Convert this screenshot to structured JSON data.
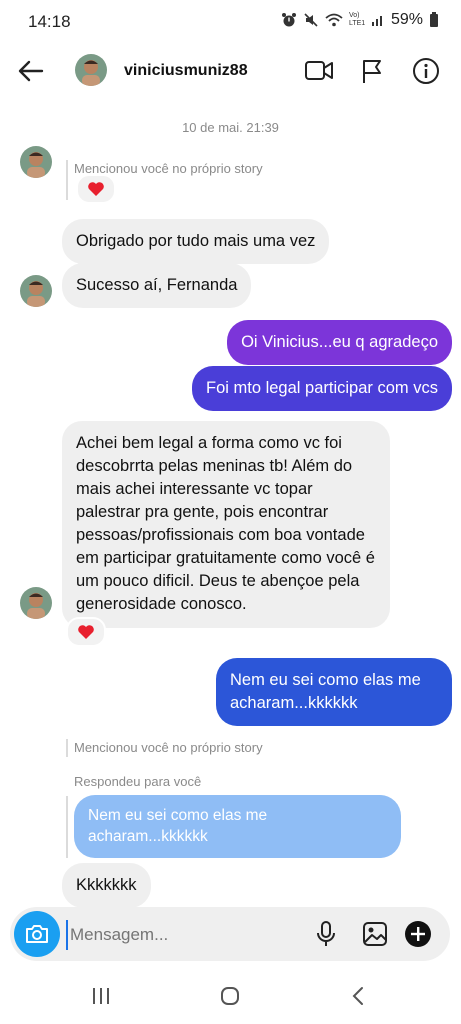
{
  "status": {
    "time": "14:18",
    "battery": "59%",
    "volte": "Vo) LTE1"
  },
  "header": {
    "username": "viniciusmuniz88"
  },
  "timestamp": "10 de mai. 21:39",
  "messages": {
    "story_mention_1": "Mencionou você no próprio story",
    "m1": "Obrigado por tudo mais uma vez",
    "m2": "Sucesso aí, Fernanda",
    "m3": "Oi Vinicius...eu q agradeço",
    "m4": "Foi mto legal participar com vcs",
    "m5": "Achei bem legal a forma como vc foi descobrrta pelas meninas tb! Além do mais achei interessante vc topar palestrar pra gente, pois encontrar pessoas/profissionais com boa vontade em participar gratuitamente como você é um pouco dificil. Deus te abençoe pela generosidade conosco.",
    "m6": "Nem eu sei como elas me acharam...kkkkkk",
    "story_mention_2": "Mencionou você no próprio story",
    "replied_label": "Respondeu para você",
    "reply_quote": "Nem eu sei como elas me acharam...kkkkkk",
    "m7": "Kkkkkkk"
  },
  "composer": {
    "placeholder": "Mensagem..."
  },
  "icons": {
    "back": "arrow-left-icon",
    "video": "video-camera-icon",
    "flag": "flag-icon",
    "info": "info-icon",
    "camera": "camera-icon",
    "mic": "microphone-icon",
    "gallery": "image-icon",
    "add": "plus-circle-icon",
    "heart": "heart-icon",
    "nav_recent": "recent-apps-icon",
    "nav_home": "home-icon",
    "nav_back": "back-nav-icon"
  },
  "colors": {
    "outgoing_top": "#7c35d9",
    "outgoing_bottom": "#2c56d8",
    "incoming": "#efefef",
    "heart": "#e8202e",
    "camera_button": "#1a9ff1",
    "reply_quote": "#8fbdf5"
  }
}
